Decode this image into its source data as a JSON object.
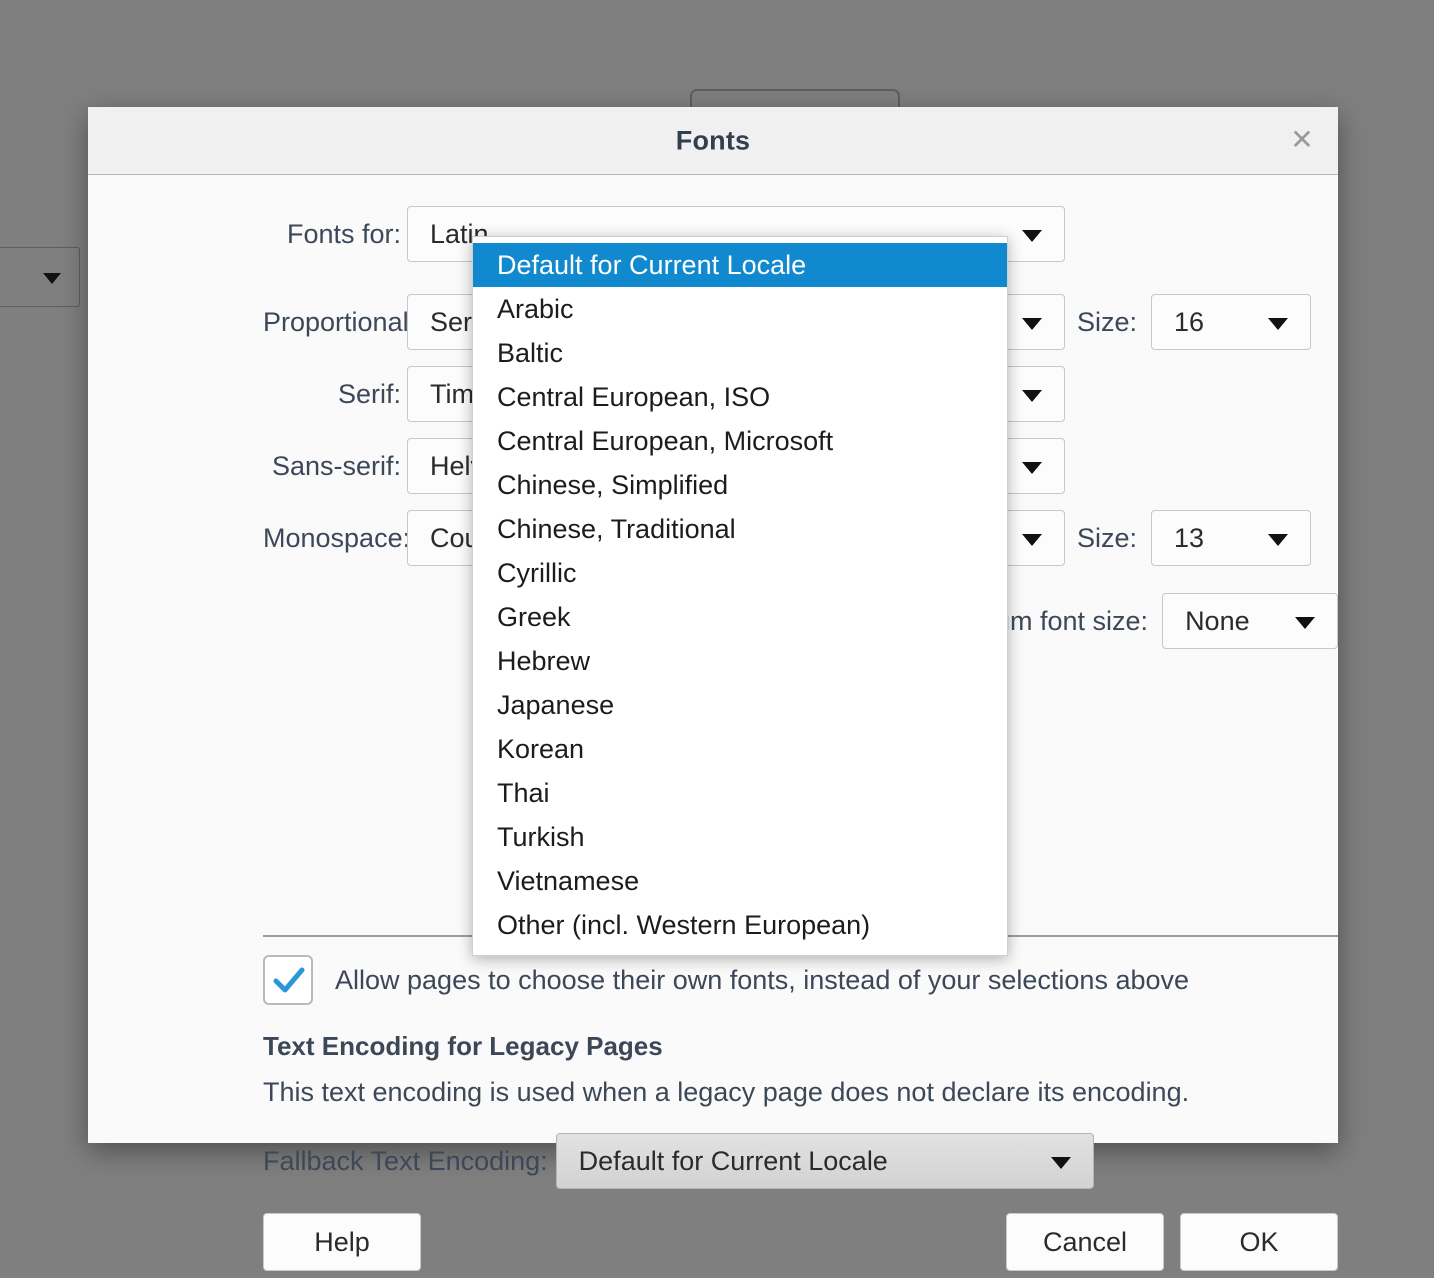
{
  "dialog": {
    "title": "Fonts",
    "close_icon": "close-icon",
    "rows": [
      {
        "label": "Fonts for:",
        "value": "Latin"
      },
      {
        "label": "Proportional:",
        "value": "Serif",
        "size_label": "Size:",
        "size_value": "16"
      },
      {
        "label": "Serif:",
        "value": "Times"
      },
      {
        "label": "Sans-serif:",
        "value": "Helvetica"
      },
      {
        "label": "Monospace:",
        "value": "Courier",
        "size_label": "Size:",
        "size_value": "13"
      }
    ],
    "minimum_font": {
      "label": "Minimum font size:",
      "short_label": "ze:",
      "value": "None"
    },
    "checkbox": {
      "checked": true,
      "label": "Allow pages to choose their own fonts, instead of your selections above"
    },
    "encoding_section": {
      "heading": "Text Encoding for Legacy Pages",
      "description": "This text encoding is used when a legacy page does not declare its encoding.",
      "field_label": "Fallback Text Encoding:",
      "field_value": "Default for Current Locale"
    },
    "buttons": {
      "help": "Help",
      "cancel": "Cancel",
      "ok": "OK"
    }
  },
  "dropdown": {
    "open": true,
    "selected_index": 0,
    "highlight_color": "#1089cf",
    "items": [
      "Default for Current Locale",
      "Arabic",
      "Baltic",
      "Central European, ISO",
      "Central European, Microsoft",
      "Chinese, Simplified",
      "Chinese, Traditional",
      "Cyrillic",
      "Greek",
      "Hebrew",
      "Japanese",
      "Korean",
      "Thai",
      "Turkish",
      "Vietnamese",
      "Other (incl. Western European)"
    ]
  },
  "theme": {
    "backdrop": "#7f7f7f",
    "dialog_bg": "#fafafa",
    "titlebar_bg": "#f0f0f0",
    "accent": "#1089cf",
    "text": "#3c4858"
  }
}
